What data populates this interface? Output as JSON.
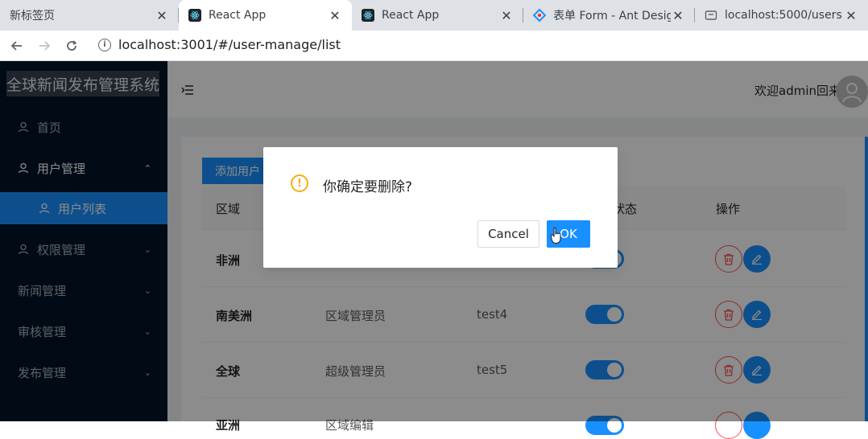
{
  "browser": {
    "tabs": [
      {
        "title": "新标签页",
        "favicon": "none"
      },
      {
        "title": "React App",
        "favicon": "react-icon"
      },
      {
        "title": "React App",
        "favicon": "react-icon"
      },
      {
        "title": "表单 Form - Ant Design",
        "favicon": "ant-design-icon"
      },
      {
        "title": "localhost:5000/users",
        "favicon": "globe-icon"
      }
    ],
    "close_glyph": "✕",
    "url": "localhost:3001/#/user-manage/list"
  },
  "sider": {
    "title": "全球新闻发布管理系统",
    "items": [
      {
        "label": "首页",
        "icon": "user-icon"
      },
      {
        "label": "用户管理",
        "icon": "user-icon",
        "arrow": "⌃"
      },
      {
        "label": "用户列表",
        "icon": "user-icon"
      },
      {
        "label": "权限管理",
        "icon": "user-icon",
        "arrow": "⌄"
      },
      {
        "label": "新闻管理",
        "arrow": "⌄"
      },
      {
        "label": "审核管理",
        "arrow": "⌄"
      },
      {
        "label": "发布管理",
        "arrow": "⌄"
      }
    ]
  },
  "header": {
    "welcome": "欢迎admin回来"
  },
  "main": {
    "add_button": "添加用户",
    "columns": [
      "区域",
      "",
      "",
      "状态",
      "操作"
    ],
    "rows": [
      {
        "region": "非洲",
        "role": "",
        "username": "",
        "state": true
      },
      {
        "region": "南美洲",
        "role": "区域管理员",
        "username": "test4",
        "state": true
      },
      {
        "region": "全球",
        "role": "超级管理员",
        "username": "test5",
        "state": true
      },
      {
        "region": "亚洲",
        "role": "区域编辑",
        "username": "",
        "state": true
      }
    ]
  },
  "modal": {
    "title": "你确定要删除?",
    "cancel": "Cancel",
    "ok": "OK"
  },
  "colors": {
    "primary": "#1890ff",
    "sider": "#001529",
    "danger": "#ff4d4f",
    "warning": "#faad14"
  }
}
